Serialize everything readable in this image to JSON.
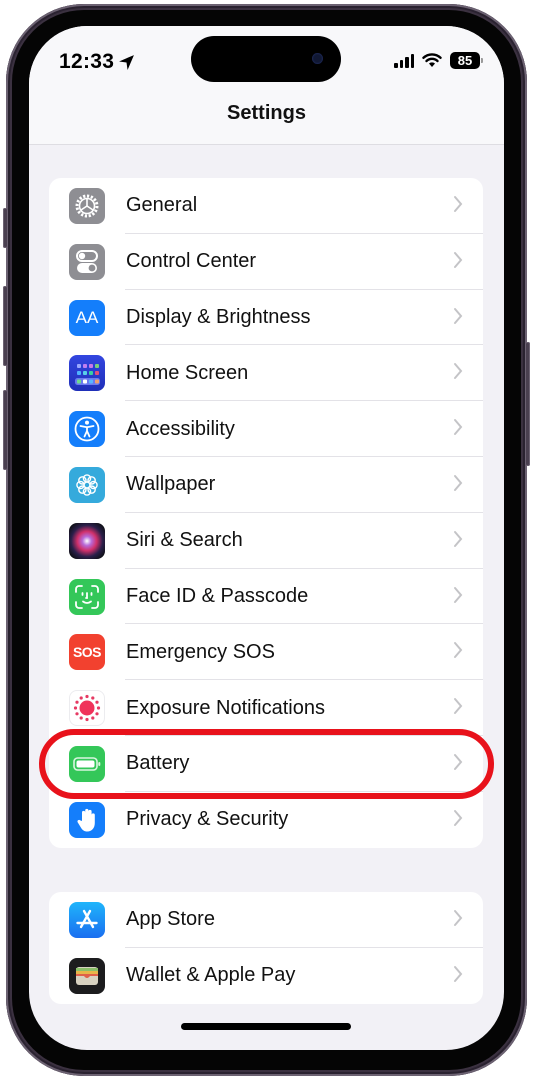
{
  "status_bar": {
    "time": "12:33",
    "location_icon": "location-arrow-icon",
    "signal_icon": "cellular-signal-icon",
    "wifi_icon": "wifi-icon",
    "battery_level": "85"
  },
  "header": {
    "title": "Settings"
  },
  "groups": [
    {
      "items": [
        {
          "label": "General",
          "icon": "gear-icon",
          "color": "#8e8e93"
        },
        {
          "label": "Control Center",
          "icon": "toggles-icon",
          "color": "#8e8e93"
        },
        {
          "label": "Display & Brightness",
          "icon": "text-size-icon",
          "color": "#147efb",
          "glyph": "AA"
        },
        {
          "label": "Home Screen",
          "icon": "home-screen-grid-icon",
          "color": "#2a3fd1"
        },
        {
          "label": "Accessibility",
          "icon": "accessibility-icon",
          "color": "#147efb"
        },
        {
          "label": "Wallpaper",
          "icon": "wallpaper-flower-icon",
          "color": "#35aadc"
        },
        {
          "label": "Siri & Search",
          "icon": "siri-icon",
          "color": "#1b1b2a"
        },
        {
          "label": "Face ID & Passcode",
          "icon": "face-id-icon",
          "color": "#34c759"
        },
        {
          "label": "Emergency SOS",
          "icon": "sos-icon",
          "color": "#f2412f",
          "glyph": "SOS"
        },
        {
          "label": "Exposure Notifications",
          "icon": "exposure-notifications-icon",
          "color": "#ffffff"
        },
        {
          "label": "Battery",
          "icon": "battery-icon",
          "color": "#34c759"
        },
        {
          "label": "Privacy & Security",
          "icon": "hand-icon",
          "color": "#147efb"
        }
      ]
    },
    {
      "items": [
        {
          "label": "App Store",
          "icon": "app-store-icon",
          "color": "#1c8ef5"
        },
        {
          "label": "Wallet & Apple Pay",
          "icon": "wallet-icon",
          "color": "#1c1c1e"
        }
      ]
    }
  ],
  "annotation": {
    "highlighted_item": "Battery",
    "color": "#e8121b"
  }
}
